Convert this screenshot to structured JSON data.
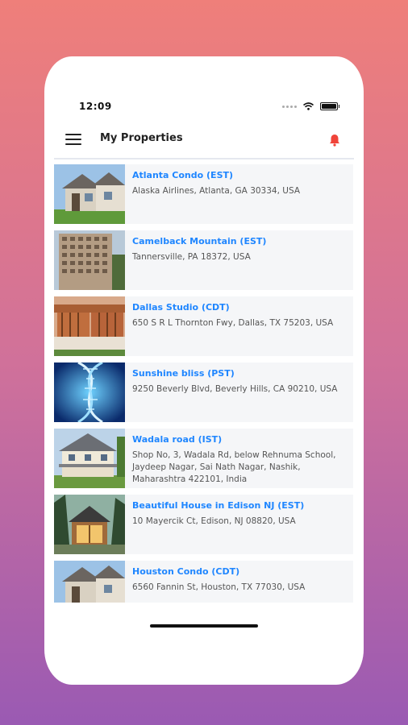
{
  "status_bar": {
    "time": "12:09"
  },
  "header": {
    "title": "My Properties"
  },
  "properties": [
    {
      "name": "Atlanta Condo (EST)",
      "address": "Alaska Airlines, Atlanta, GA 30334, USA",
      "thumb": "house-icon"
    },
    {
      "name": "Camelback Mountain (EST)",
      "address": "Tannersville, PA 18372, USA",
      "thumb": "building-icon"
    },
    {
      "name": "Dallas Studio (CDT)",
      "address": "650 S R L Thornton Fwy, Dallas, TX 75203, USA",
      "thumb": "modern-house-icon"
    },
    {
      "name": "Sunshine bliss (PST)",
      "address": "9250 Beverly Blvd, Beverly Hills, CA 90210, USA",
      "thumb": "dna-icon"
    },
    {
      "name": "Wadala road (IST)",
      "address": "Shop No, 3, Wadala Rd, below Rehnuma School, Jaydeep Nagar, Sai Nath Nagar, Nashik, Maharashtra 422101, India",
      "thumb": "porch-house-icon"
    },
    {
      "name": "Beautiful House in Edison NJ (EST)",
      "address": "10 Mayercik Ct, Edison, NJ 08820, USA",
      "thumb": "cabin-icon"
    },
    {
      "name": "Houston Condo (CDT)",
      "address": "6560 Fannin St, Houston, TX 77030, USA",
      "thumb": "house-icon"
    }
  ],
  "colors": {
    "accent": "#1f86ff",
    "bell": "#f0443a"
  }
}
